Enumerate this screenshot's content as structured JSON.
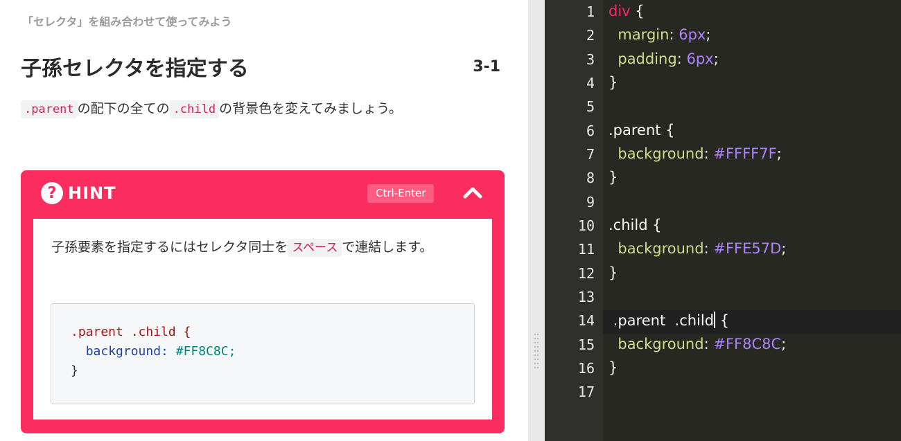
{
  "lesson": {
    "breadcrumb": "「セレクタ」を組み合わせて使ってみよう",
    "title": "子孫セレクタを指定する",
    "number": "3-1",
    "instruction": {
      "chip_parent": ".parent",
      "text_1": "の配下の全ての",
      "chip_child": ".child",
      "text_2": "の背景色を変えてみましょう。"
    }
  },
  "hint": {
    "icon": "question-circle-icon",
    "label": "HINT",
    "shortcut": "Ctrl-Enter",
    "collapse_icon": "chevron-up-icon",
    "text_1": "子孫要素を指定するにはセレクタ同士を",
    "chip": "スペース",
    "text_2": "で連結します。",
    "example": {
      "selector": ".parent .child {",
      "property": "background:",
      "value": "#FF8C8C;",
      "close": "}"
    }
  },
  "editor": {
    "line_numbers": [
      "1",
      "2",
      "3",
      "4",
      "5",
      "6",
      "7",
      "8",
      "9",
      "10",
      "11",
      "12",
      "13",
      "14",
      "15",
      "16",
      "17"
    ],
    "active_line": 14,
    "lines": {
      "l1_sel": "div",
      "l1_brace": " {",
      "l2_prop": "margin",
      "l2_colon": ": ",
      "l2_val": "6px",
      "l2_semi": ";",
      "l3_prop": "padding",
      "l3_colon": ": ",
      "l3_val": "6px",
      "l3_semi": ";",
      "l4": "}",
      "l6_sel": ".parent",
      "l6_brace": " {",
      "l7_prop": "background",
      "l7_colon": ": ",
      "l7_val": "#FFFF7F",
      "l7_semi": ";",
      "l8": "}",
      "l10_sel": ".child",
      "l10_brace": " {",
      "l11_prop": "background",
      "l11_colon": ": ",
      "l11_val": "#FFE57D",
      "l11_semi": ";",
      "l12": "}",
      "l14_sel": " .parent  .child",
      "l14_brace": " {",
      "l15_prop": "background",
      "l15_colon": ": ",
      "l15_val": "#FF8C8C",
      "l15_semi": ";",
      "l16": "}"
    }
  },
  "colors": {
    "hint_accent": "#fb2d5f",
    "editor_bg": "#272822",
    "selector_tag": "#f92672",
    "property": "#d2dd8c",
    "value": "#ae81ff",
    "chip_text": "#d4204e"
  }
}
